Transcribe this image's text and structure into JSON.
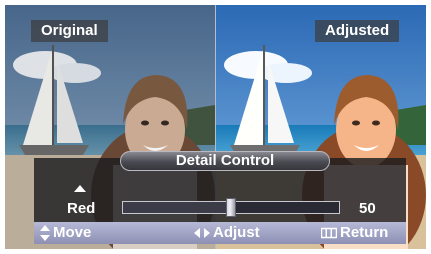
{
  "captions": {
    "left": "Original",
    "right": "Adjusted"
  },
  "osd": {
    "title": "Detail Control",
    "item_label": "Red",
    "slider": {
      "value": "50",
      "fraction": 0.5
    },
    "footer": {
      "move": "Move",
      "adjust": "Adjust",
      "return": "Return"
    }
  },
  "icons": {
    "move": "up-down-arrow-icon",
    "adjust": "left-right-arrow-icon",
    "return": "menu-icon"
  },
  "colors": {
    "osd_bg": "#1c1c20",
    "footer_bg": "#9ea1c4",
    "caption_bg": "#3c3c3c"
  }
}
